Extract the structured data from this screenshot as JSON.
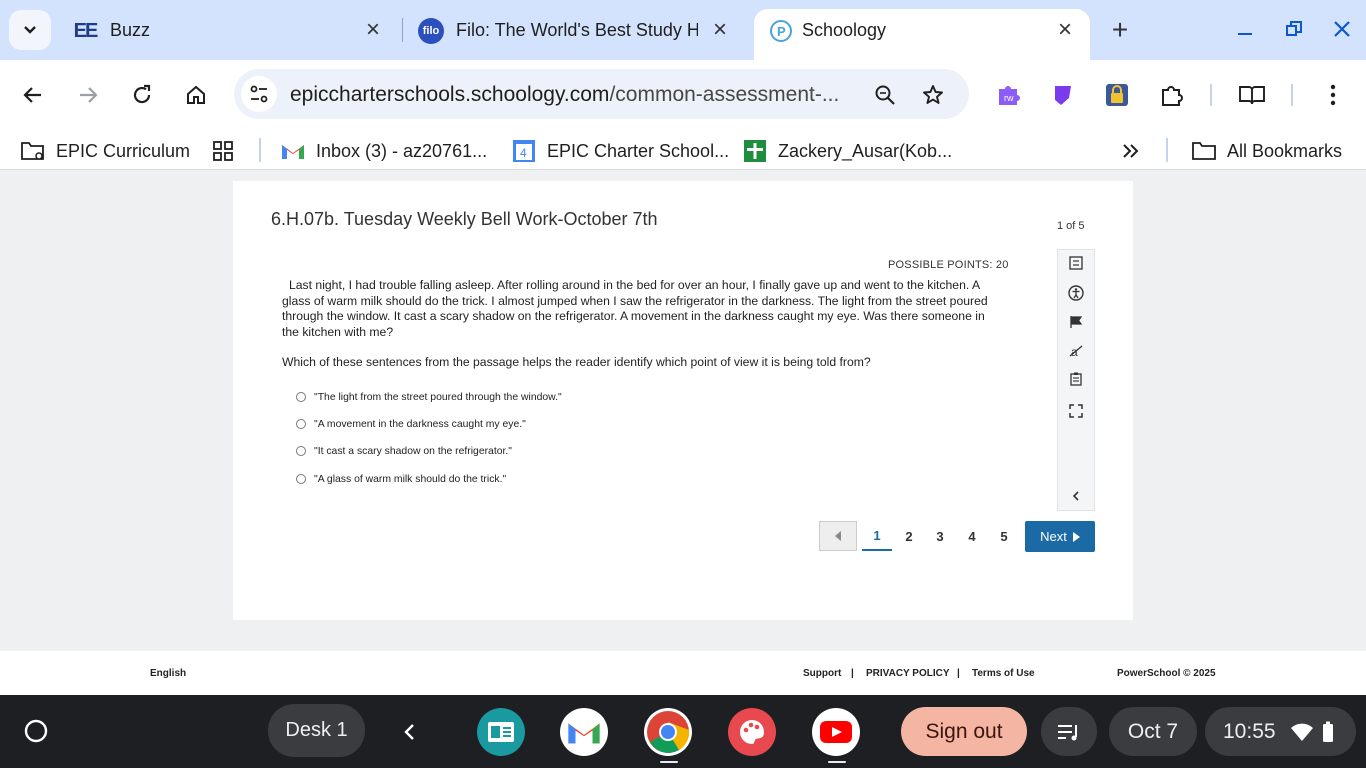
{
  "browser": {
    "tabs": [
      {
        "title": "Buzz",
        "favicon": "EE"
      },
      {
        "title": "Filo: The World's Best Study H",
        "favicon": "filo"
      },
      {
        "title": "Schoology",
        "favicon": "schoology-icon"
      }
    ],
    "url_main": "epiccharterschools.schoology.com",
    "url_path": "/common-assessment-..."
  },
  "bookmarks": [
    {
      "label": "EPIC Curriculum"
    },
    {
      "label": "Inbox (3) - az20761..."
    },
    {
      "label": "EPIC Charter School..."
    },
    {
      "label": "Zackery_Ausar(Kob..."
    },
    {
      "label": "All Bookmarks"
    }
  ],
  "assessment": {
    "title": "6.H.07b. Tuesday Weekly Bell Work-October 7th",
    "page_count": "1 of 5",
    "possible_points": "POSSIBLE POINTS: 20",
    "passage": "Last night, I had trouble falling asleep. After rolling around in the bed for over an hour, I finally gave up and went to the kitchen. A glass of warm milk should do the trick. I almost jumped when I saw the refrigerator in the darkness. The light from the street poured through the window. It cast a scary shadow on the refrigerator. A movement in the darkness caught my eye. Was there someone in the kitchen with me?",
    "question": "Which of these sentences from the passage helps the reader identify which point of view it is being told from?",
    "choices": [
      "\"The light from the street poured through the window.\"",
      "\"A movement in the darkness caught my eye.\"",
      "\"It cast a scary shadow on the refrigerator.\"",
      "\"A glass of warm milk should do the trick.\""
    ],
    "pages": [
      "1",
      "2",
      "3",
      "4",
      "5"
    ],
    "current_page": "1",
    "next_label": "Next"
  },
  "footer": {
    "language": "English",
    "support": "Support",
    "privacy": "PRIVACY POLICY",
    "terms": "Terms of Use",
    "copyright": "PowerSchool © 2025",
    "sep": "|"
  },
  "shelf": {
    "desk": "Desk 1",
    "sign_out": "Sign out",
    "date": "Oct 7",
    "time": "10:55"
  },
  "colors": {
    "tabstrip": "#d3e3fd",
    "accent": "#1b6aa5",
    "shelf": "#1e1f22",
    "signout": "#f5b5a3"
  }
}
